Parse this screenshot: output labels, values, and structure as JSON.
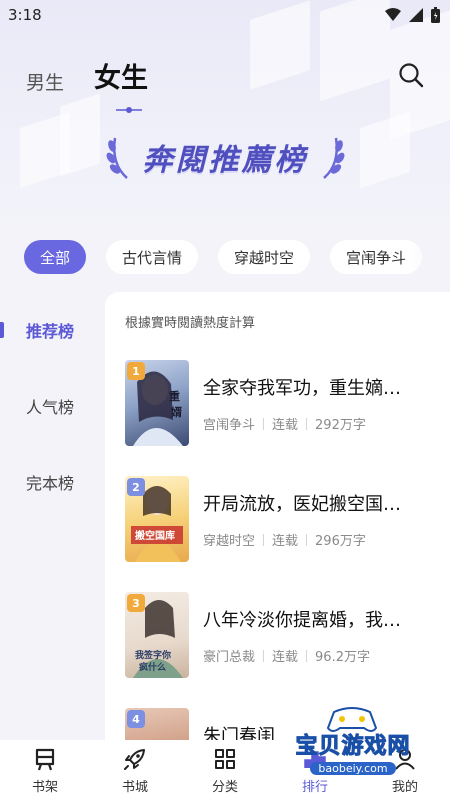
{
  "status_bar": {
    "time": "3:18"
  },
  "header": {
    "tabs": [
      {
        "label": "男生"
      },
      {
        "label": "女生"
      }
    ],
    "active_tab": "女生"
  },
  "banner": {
    "title": "奔閱推薦榜"
  },
  "categories": [
    {
      "label": "全部",
      "active": true
    },
    {
      "label": "古代言情"
    },
    {
      "label": "穿越时空"
    },
    {
      "label": "宫闱争斗"
    }
  ],
  "side_nav": [
    {
      "label": "推荐榜",
      "active": true
    },
    {
      "label": "人气榜"
    },
    {
      "label": "完本榜"
    }
  ],
  "panel": {
    "note": "根據實時閱讀熱度計算",
    "books": [
      {
        "rank": "1",
        "title": "全家夺我军功，重生嫡…",
        "genre": "宫闱争斗",
        "status": "连载",
        "words": "292万字"
      },
      {
        "rank": "2",
        "title": "开局流放，医妃搬空国…",
        "genre": "穿越时空",
        "status": "连载",
        "words": "296万字"
      },
      {
        "rank": "3",
        "title": "八年冷淡你提离婚，我…",
        "genre": "豪门总裁",
        "status": "连载",
        "words": "96.2万字"
      },
      {
        "rank": "4",
        "title": "朱门春闺",
        "genre": "",
        "status": "",
        "words": ""
      }
    ]
  },
  "bottom_nav": [
    {
      "label": "书架",
      "icon": "bookshelf-icon"
    },
    {
      "label": "书城",
      "icon": "rocket-icon"
    },
    {
      "label": "分类",
      "icon": "category-icon"
    },
    {
      "label": "排行",
      "icon": "ranking-icon",
      "active": true
    },
    {
      "label": "我的",
      "icon": "profile-icon"
    }
  ],
  "watermark": {
    "text": "宝贝游戏网",
    "url": "baobeiy.com"
  },
  "colors": {
    "accent": "#5b59d6",
    "chip_active": "#6a68e0",
    "rank_gold": "#f2a93b",
    "rank_blue": "#7d8fe0"
  }
}
